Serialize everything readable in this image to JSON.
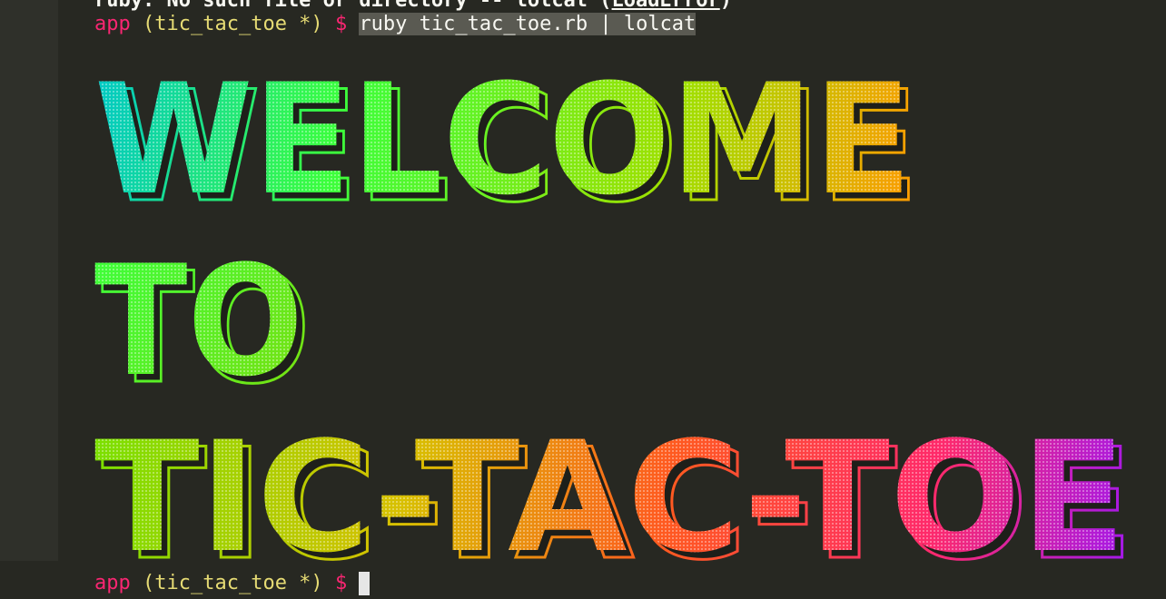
{
  "terminal": {
    "error_line_1": "ruby: No such file or directory -- lolcat (",
    "error_link": "LoadError",
    "error_line_2": ")",
    "prompt_app": "app",
    "prompt_branch": "(tic_tac_toe *)",
    "prompt_dollar": "$",
    "command": "ruby tic_tac_toe.rb | lolcat",
    "banner_line_1": "WELCOME",
    "banner_line_2": "TO",
    "banner_line_3": "TIC-TAC-TOE"
  },
  "colors": {
    "background": "#272822",
    "gutter": "#2f302a",
    "prompt": "#f92672",
    "branch": "#e6db74",
    "gradient": [
      "#00c8c8",
      "#3cff3c",
      "#a0e000",
      "#ff9a00",
      "#ff2a6a",
      "#a018f0"
    ]
  }
}
